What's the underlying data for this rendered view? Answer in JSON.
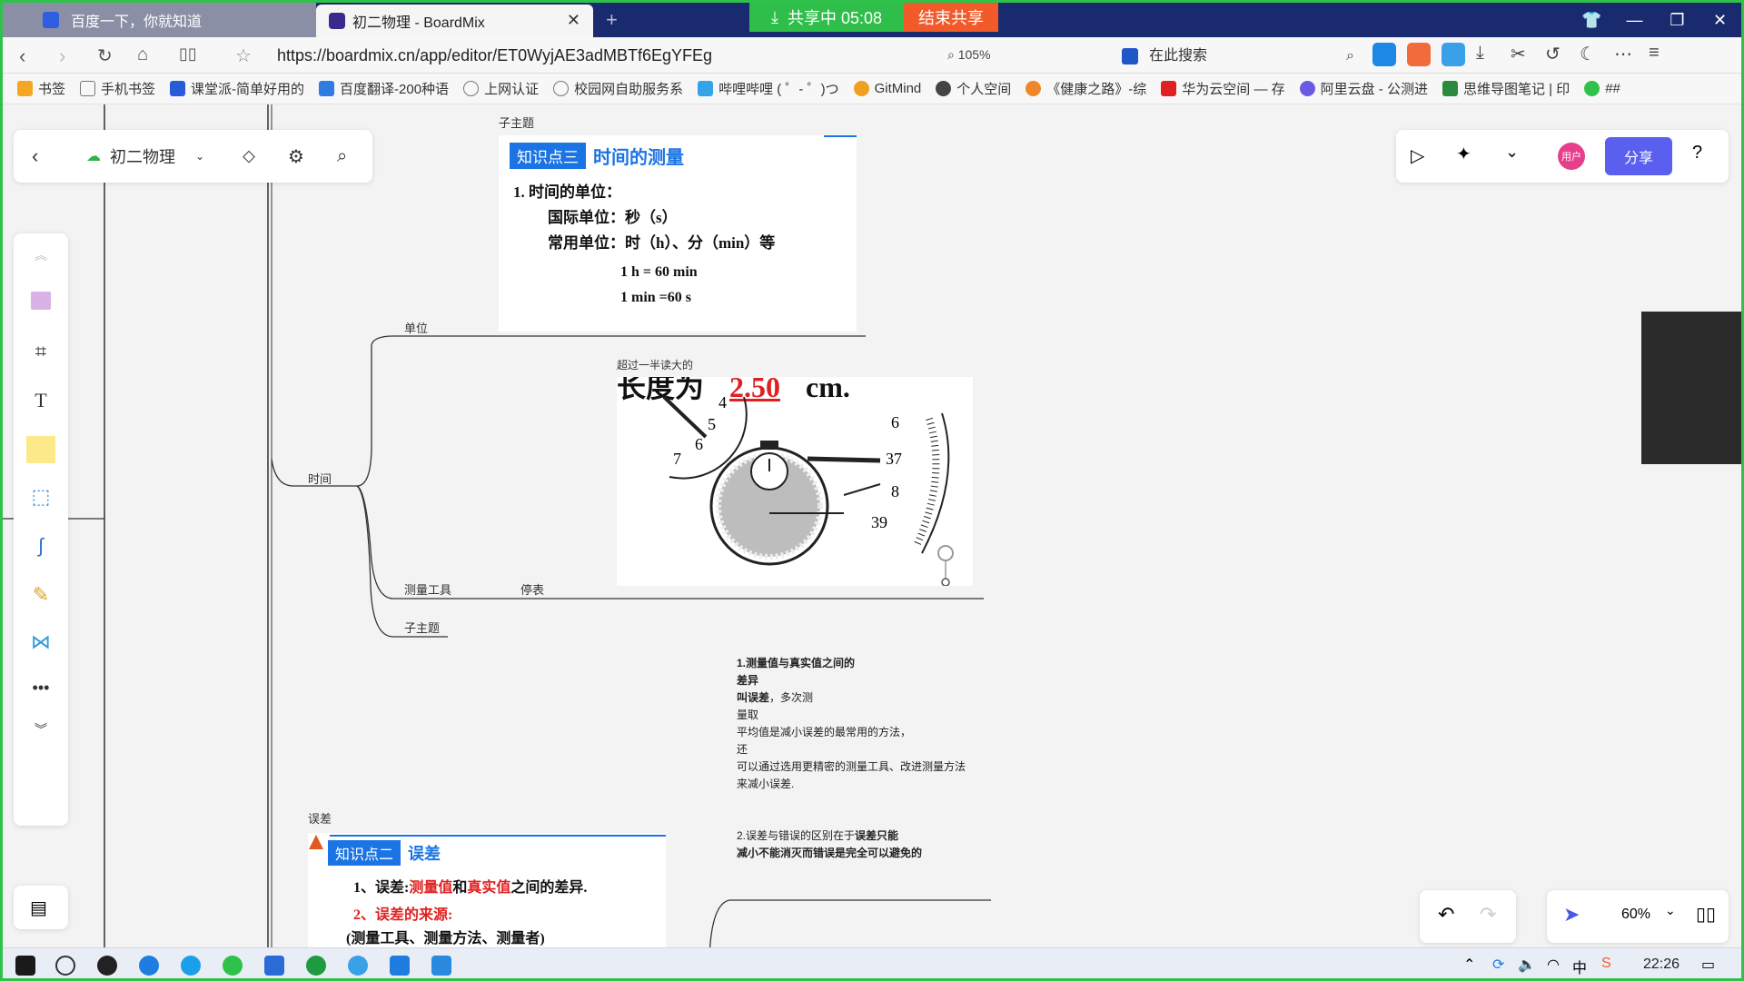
{
  "browser": {
    "tabs": [
      {
        "label": "百度一下，你就知道"
      },
      {
        "label": "初二物理 - BoardMix"
      }
    ],
    "sharing_status": "共享中 05:08",
    "end_share_label": "结束共享",
    "url": "https://boardmix.cn/app/editor/ET0WyjAE3adMBTf6EgYFEg",
    "zoom": "105%",
    "search_placeholder": "在此搜索",
    "bookmarks": [
      "书签",
      "手机书签",
      "课堂派-简单好用的",
      "百度翻译-200种语",
      "上网认证",
      "校园网自助服务系",
      "哔哩哔哩 ( ゜- ゜)つ",
      "GitMind",
      "个人空间",
      "《健康之路》-综",
      "华为云空间 — 存",
      "阿里云盘 - 公测进",
      "思维导图笔记 | 印",
      "##"
    ]
  },
  "editor": {
    "board_name": "初二物理",
    "share_label": "分享",
    "user_label": "用户",
    "zoom_level": "60%"
  },
  "board": {
    "topic_top": "子主题",
    "card_time": {
      "tag": "知识点三",
      "title": "时间的测量",
      "line1": "1. 时间的单位：",
      "line2": "国际单位：秒（s）",
      "line3": "常用单位：时（h）、分（min）等",
      "eq1": "1 h = 60 min",
      "eq2": "1 min =60 s"
    },
    "branch_unit": "单位",
    "branch_time": "时间",
    "note_over_half": "超过一半读大的",
    "stopwatch_top_text": "长度为",
    "stopwatch_top_val": "2.50",
    "stopwatch_top_unit": "cm.",
    "branch_tool": "测量工具",
    "branch_stopwatch": "停表",
    "branch_sub": "子主题",
    "error_note": {
      "l1": "1.测量值与真实值之间的",
      "l2": "差异",
      "l3b": "叫误差",
      "l3": "，多次测",
      "l4": "量取",
      "l5": "平均值是减小误差的最常用的方法，",
      "l6": "还",
      "l7": "可以通过选用更精密的测量工具、改进测量方法",
      "l8": "来减小误差.",
      "l9a": "2.误差与错误的区别在于",
      "l9b": "误差只能",
      "l10": "减小不能消灭而错误是完全可以避免的"
    },
    "branch_error": "误差",
    "card_error": {
      "tag": "知识点二",
      "title": "误差",
      "l1a": "1、误差:",
      "l1b": "测量值",
      "l1c": "和",
      "l1d": "真实值",
      "l1e": "之间的差异.",
      "l2": "2、误差的来源:",
      "l3": "(测量工具、测量方法、测量者)"
    }
  },
  "taskbar": {
    "time": "22:26"
  }
}
